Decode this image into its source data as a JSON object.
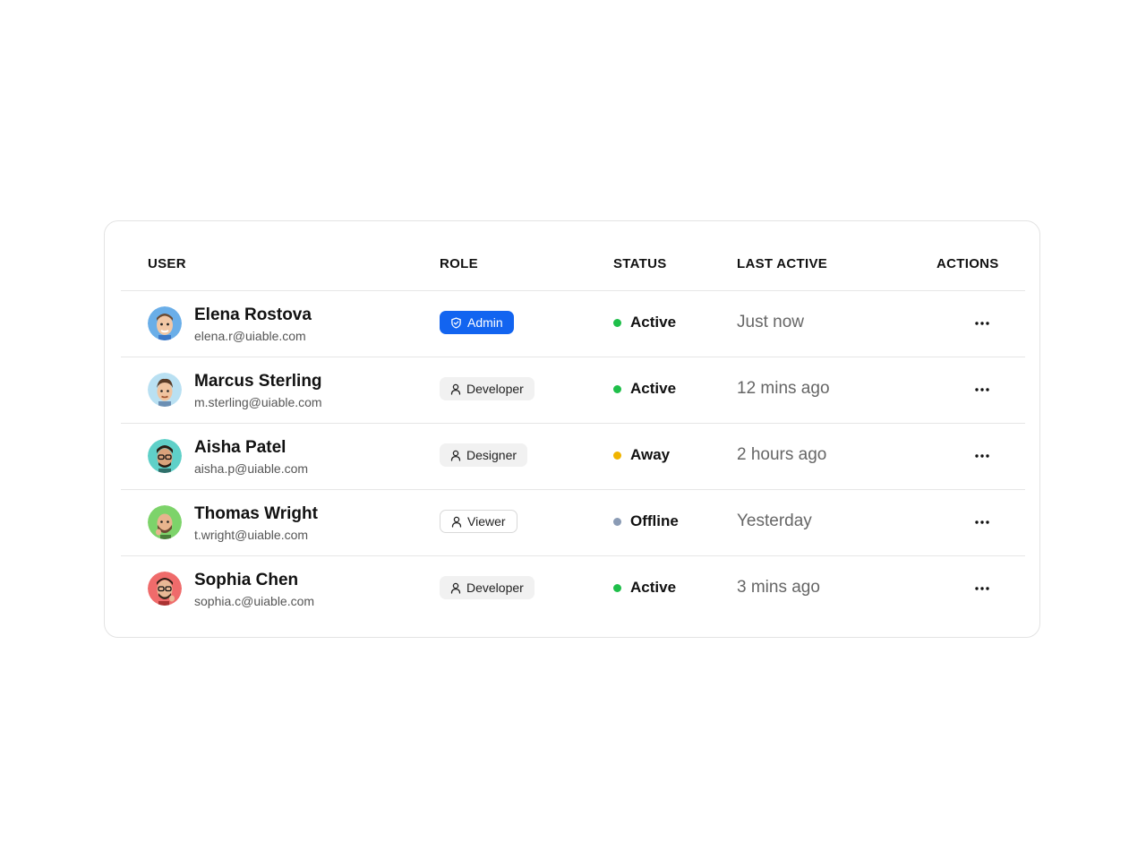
{
  "table": {
    "headers": {
      "user": "USER",
      "role": "ROLE",
      "status": "STATUS",
      "last_active": "LAST ACTIVE",
      "actions": "ACTIONS"
    },
    "rows": [
      {
        "name": "Elena Rostova",
        "email": "elena.r@uiable.com",
        "role": "Admin",
        "role_icon": "shield-icon",
        "status": "Active",
        "status_color": "#1fbf4a",
        "last_active": "Just now",
        "avatar_bg": "#6aaee8"
      },
      {
        "name": "Marcus Sterling",
        "email": "m.sterling@uiable.com",
        "role": "Developer",
        "role_icon": "user-icon",
        "status": "Active",
        "status_color": "#1fbf4a",
        "last_active": "12 mins ago",
        "avatar_bg": "#b9e0f2"
      },
      {
        "name": "Aisha Patel",
        "email": "aisha.p@uiable.com",
        "role": "Designer",
        "role_icon": "user-icon",
        "status": "Away",
        "status_color": "#f0b400",
        "last_active": "2 hours ago",
        "avatar_bg": "#5fd0c8"
      },
      {
        "name": "Thomas Wright",
        "email": "t.wright@uiable.com",
        "role": "Viewer",
        "role_icon": "user-icon",
        "status": "Offline",
        "status_color": "#8a9bb5",
        "last_active": "Yesterday",
        "avatar_bg": "#7dd36a"
      },
      {
        "name": "Sophia Chen",
        "email": "sophia.c@uiable.com",
        "role": "Developer",
        "role_icon": "user-icon",
        "status": "Active",
        "status_color": "#1fbf4a",
        "last_active": "3 mins ago",
        "avatar_bg": "#ef6b6b"
      }
    ]
  },
  "colors": {
    "admin_badge": "#1264f0",
    "chip_bg": "#f1f1f1",
    "divider": "#e6e6e6"
  }
}
